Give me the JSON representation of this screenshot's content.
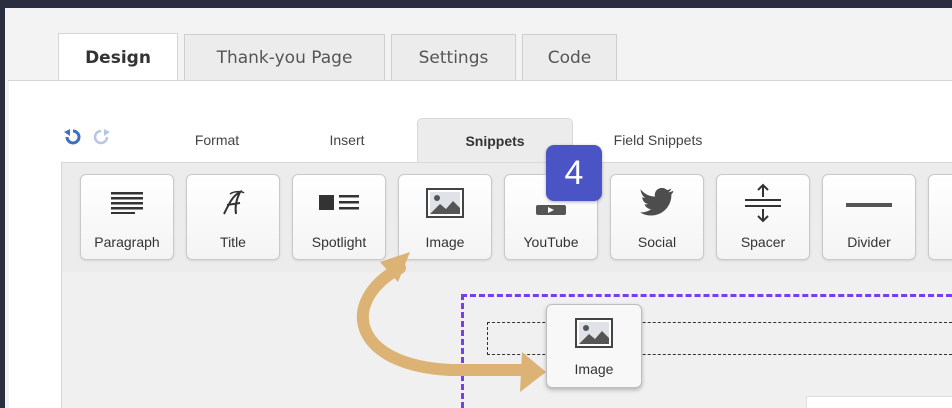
{
  "main_tabs": [
    {
      "label": "Design"
    },
    {
      "label": "Thank-you Page"
    },
    {
      "label": "Settings"
    },
    {
      "label": "Code"
    }
  ],
  "active_main_tab": "Design",
  "sub_tabs": [
    {
      "label": "Format"
    },
    {
      "label": "Insert"
    },
    {
      "label": "Snippets"
    },
    {
      "label": "Field Snippets"
    }
  ],
  "active_sub_tab": "Snippets",
  "snippets": [
    {
      "label": "Paragraph",
      "icon": "paragraph-icon"
    },
    {
      "label": "Title",
      "icon": "title-icon"
    },
    {
      "label": "Spotlight",
      "icon": "spotlight-icon"
    },
    {
      "label": "Image",
      "icon": "image-icon"
    },
    {
      "label": "YouTube",
      "icon": "youtube-icon"
    },
    {
      "label": "Social",
      "icon": "twitter-icon"
    },
    {
      "label": "Spacer",
      "icon": "spacer-icon"
    },
    {
      "label": "Divider",
      "icon": "divider-icon"
    }
  ],
  "step_badge": "4",
  "drag_ghost": {
    "label": "Image",
    "icon": "image-icon"
  },
  "colors": {
    "accent_purple": "#7a3cf0",
    "badge_blue": "#4b54c4",
    "arrow_tan": "#dcb374",
    "topbar": "#2b2e3e"
  }
}
